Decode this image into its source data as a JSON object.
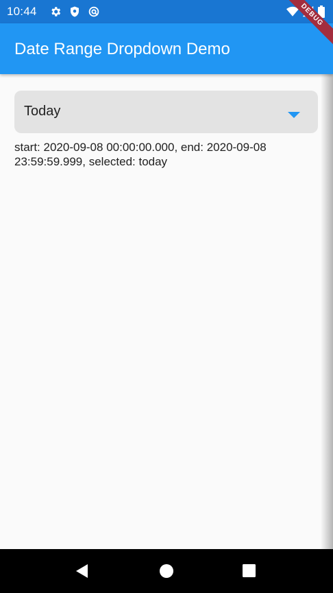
{
  "status_bar": {
    "time": "10:44",
    "icons_left": [
      "gear-icon",
      "shield-icon",
      "vpn-icon"
    ],
    "icons_right": [
      "wifi-icon",
      "signal-icon",
      "battery-icon"
    ]
  },
  "debug_banner": {
    "label": "DEBUG",
    "color": "#a32d3e"
  },
  "app_bar": {
    "title": "Date Range Dropdown Demo",
    "color": "#2196f3"
  },
  "dropdown": {
    "selected_label": "Today",
    "arrow_color": "#2196f3"
  },
  "result": {
    "text": "start: 2020-09-08 00:00:00.000, end: 2020-09-08 23:59:59.999, selected: today"
  },
  "nav_bar": {
    "buttons": [
      "back-icon",
      "home-icon",
      "recents-icon"
    ]
  }
}
